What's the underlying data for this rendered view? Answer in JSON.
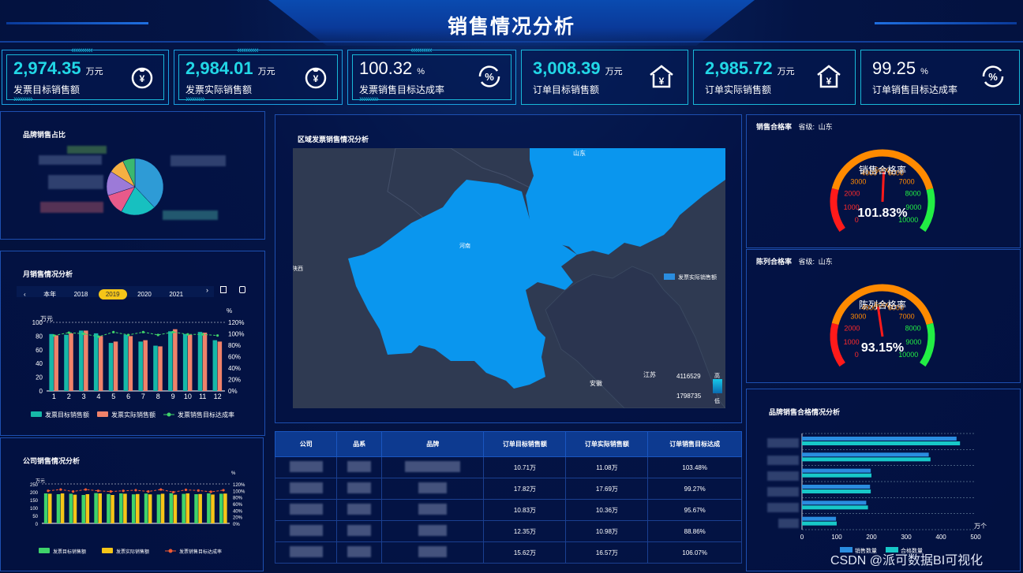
{
  "page_title": "销售情况分析",
  "kpis": [
    {
      "value": "2,974.35",
      "unit": "万元",
      "label": "发票目标销售额",
      "icon": "money-bag-icon"
    },
    {
      "value": "2,984.01",
      "unit": "万元",
      "label": "发票实际销售额",
      "icon": "money-bag-icon"
    },
    {
      "value": "100.32",
      "unit": "%",
      "label": "发票销售目标达成率",
      "icon": "percent-cycle-icon"
    },
    {
      "value": "3,008.39",
      "unit": "万元",
      "label": "订单目标销售额",
      "icon": "house-yen-icon"
    },
    {
      "value": "2,985.72",
      "unit": "万元",
      "label": "订单实际销售额",
      "icon": "house-yen-icon"
    },
    {
      "value": "99.25",
      "unit": "%",
      "label": "订单销售目标达成率",
      "icon": "percent-cycle-icon"
    }
  ],
  "brand_panel": {
    "title": "品牌销售占比"
  },
  "monthly_panel": {
    "title": "月销售情况分析",
    "years": [
      "本年",
      "2018",
      "2019",
      "2020",
      "2021"
    ],
    "selected_year": "2019",
    "y_unit_left": "万元",
    "y_unit_right": "%"
  },
  "company_panel": {
    "title": "公司销售情况分析",
    "y_unit_left": "万元",
    "y_unit_right": "%"
  },
  "map_panel": {
    "title": "区域发票销售情况分析",
    "legend": "发票实际销售额",
    "labels": [
      "山东",
      "河南",
      "陕西",
      "安徽",
      "江苏"
    ],
    "range_high": "4116529",
    "range_low": "1798735",
    "high_label": "高",
    "low_label": "低"
  },
  "gauge1": {
    "title": "销售合格率",
    "filter_label": "省级:",
    "filter_value": "山东",
    "name": "销售合格率",
    "value": "101.83%"
  },
  "gauge2": {
    "title": "陈列合格率",
    "filter_label": "省级:",
    "filter_value": "山东",
    "name": "陈列合格率",
    "value": "93.15%"
  },
  "gauge_ticks": [
    "0",
    "1000",
    "2000",
    "3000",
    "4000",
    "5000",
    "6000",
    "7000",
    "8000",
    "9000",
    "10000"
  ],
  "brand_quality_panel": {
    "title": "品牌销售合格情况分析",
    "unit": "万个"
  },
  "table": {
    "headers": [
      "公司",
      "品系",
      "品牌",
      "订单目标销售额",
      "订单实际销售额",
      "订单销售目标达成"
    ],
    "rows": [
      {
        "target": "10.71万",
        "actual": "11.08万",
        "rate": "103.48%"
      },
      {
        "target": "17.82万",
        "actual": "17.69万",
        "rate": "99.27%"
      },
      {
        "target": "10.83万",
        "actual": "10.36万",
        "rate": "95.67%"
      },
      {
        "target": "12.35万",
        "actual": "10.98万",
        "rate": "88.86%"
      },
      {
        "target": "15.62万",
        "actual": "16.57万",
        "rate": "106.07%"
      }
    ]
  },
  "watermark": "CSDN @派可数据BI可视化",
  "chart_data": [
    {
      "type": "pie",
      "title": "品牌销售占比",
      "values": [
        38,
        20,
        12,
        14,
        9,
        7
      ],
      "colors": [
        "#2e9bd6",
        "#17c0c0",
        "#e85a8a",
        "#9c7ad8",
        "#f5b042",
        "#3ab870"
      ]
    },
    {
      "type": "bar",
      "title": "月销售情况分析",
      "categories": [
        "1",
        "2",
        "3",
        "4",
        "5",
        "6",
        "7",
        "8",
        "9",
        "10",
        "11",
        "12"
      ],
      "series": [
        {
          "name": "发票目标销售额",
          "values": [
            83,
            82,
            88,
            84,
            70,
            82,
            72,
            66,
            87,
            83,
            86,
            74
          ],
          "color": "#17b8a8"
        },
        {
          "name": "发票实际销售额",
          "values": [
            81,
            84,
            88,
            80,
            72,
            80,
            74,
            65,
            90,
            82,
            85,
            72
          ],
          "color": "#f0826a"
        },
        {
          "name": "发票销售目标达成率",
          "values": [
            97,
            102,
            100,
            95,
            103,
            98,
            103,
            98,
            103,
            99,
            99,
            97
          ],
          "color": "#3fd36a",
          "axis": "right"
        }
      ],
      "ylim": [
        0,
        100
      ],
      "ylim_right": [
        0,
        120
      ],
      "yticks": [
        "0",
        "20",
        "40",
        "60",
        "80",
        "100"
      ],
      "yticks_right": [
        "0%",
        "20%",
        "40%",
        "60%",
        "80%",
        "100%",
        "120%"
      ]
    },
    {
      "type": "bar",
      "title": "公司销售情况分析",
      "series": [
        {
          "name": "发票目标销售额",
          "values": [
            190,
            185,
            188,
            180,
            192,
            186,
            190,
            184,
            189,
            183,
            191,
            187,
            185,
            190,
            188
          ],
          "color": "#3fd36a"
        },
        {
          "name": "发票实际销售额",
          "values": [
            188,
            190,
            182,
            185,
            190,
            180,
            188,
            186,
            184,
            188,
            182,
            190,
            186,
            183,
            189
          ],
          "color": "#f5c518"
        },
        {
          "name": "发票销售目标达成率",
          "values": [
            99,
            103,
            97,
            103,
            99,
            97,
            99,
            101,
            97,
            103,
            95,
            102,
            100,
            96,
            101
          ],
          "color": "#f05a32",
          "axis": "right"
        }
      ],
      "ylim": [
        0,
        250
      ],
      "ylim_right": [
        0,
        120
      ],
      "yticks": [
        "0",
        "50",
        "100",
        "150",
        "200",
        "250"
      ],
      "yticks_right": [
        "0%",
        "20%",
        "40%",
        "60%",
        "80%",
        "100%",
        "120%"
      ]
    },
    {
      "type": "bar",
      "orientation": "horizontal",
      "title": "品牌销售合格情况分析",
      "series": [
        {
          "name": "销售数量",
          "values": [
            445,
            365,
            198,
            196,
            185,
            98
          ],
          "color": "#2a8de0"
        },
        {
          "name": "合格数量",
          "values": [
            455,
            370,
            200,
            198,
            190,
            100
          ],
          "color": "#17c8c8"
        }
      ],
      "xlim": [
        0,
        500
      ],
      "xticks": [
        "0",
        "100",
        "200",
        "300",
        "400",
        "500"
      ]
    }
  ]
}
